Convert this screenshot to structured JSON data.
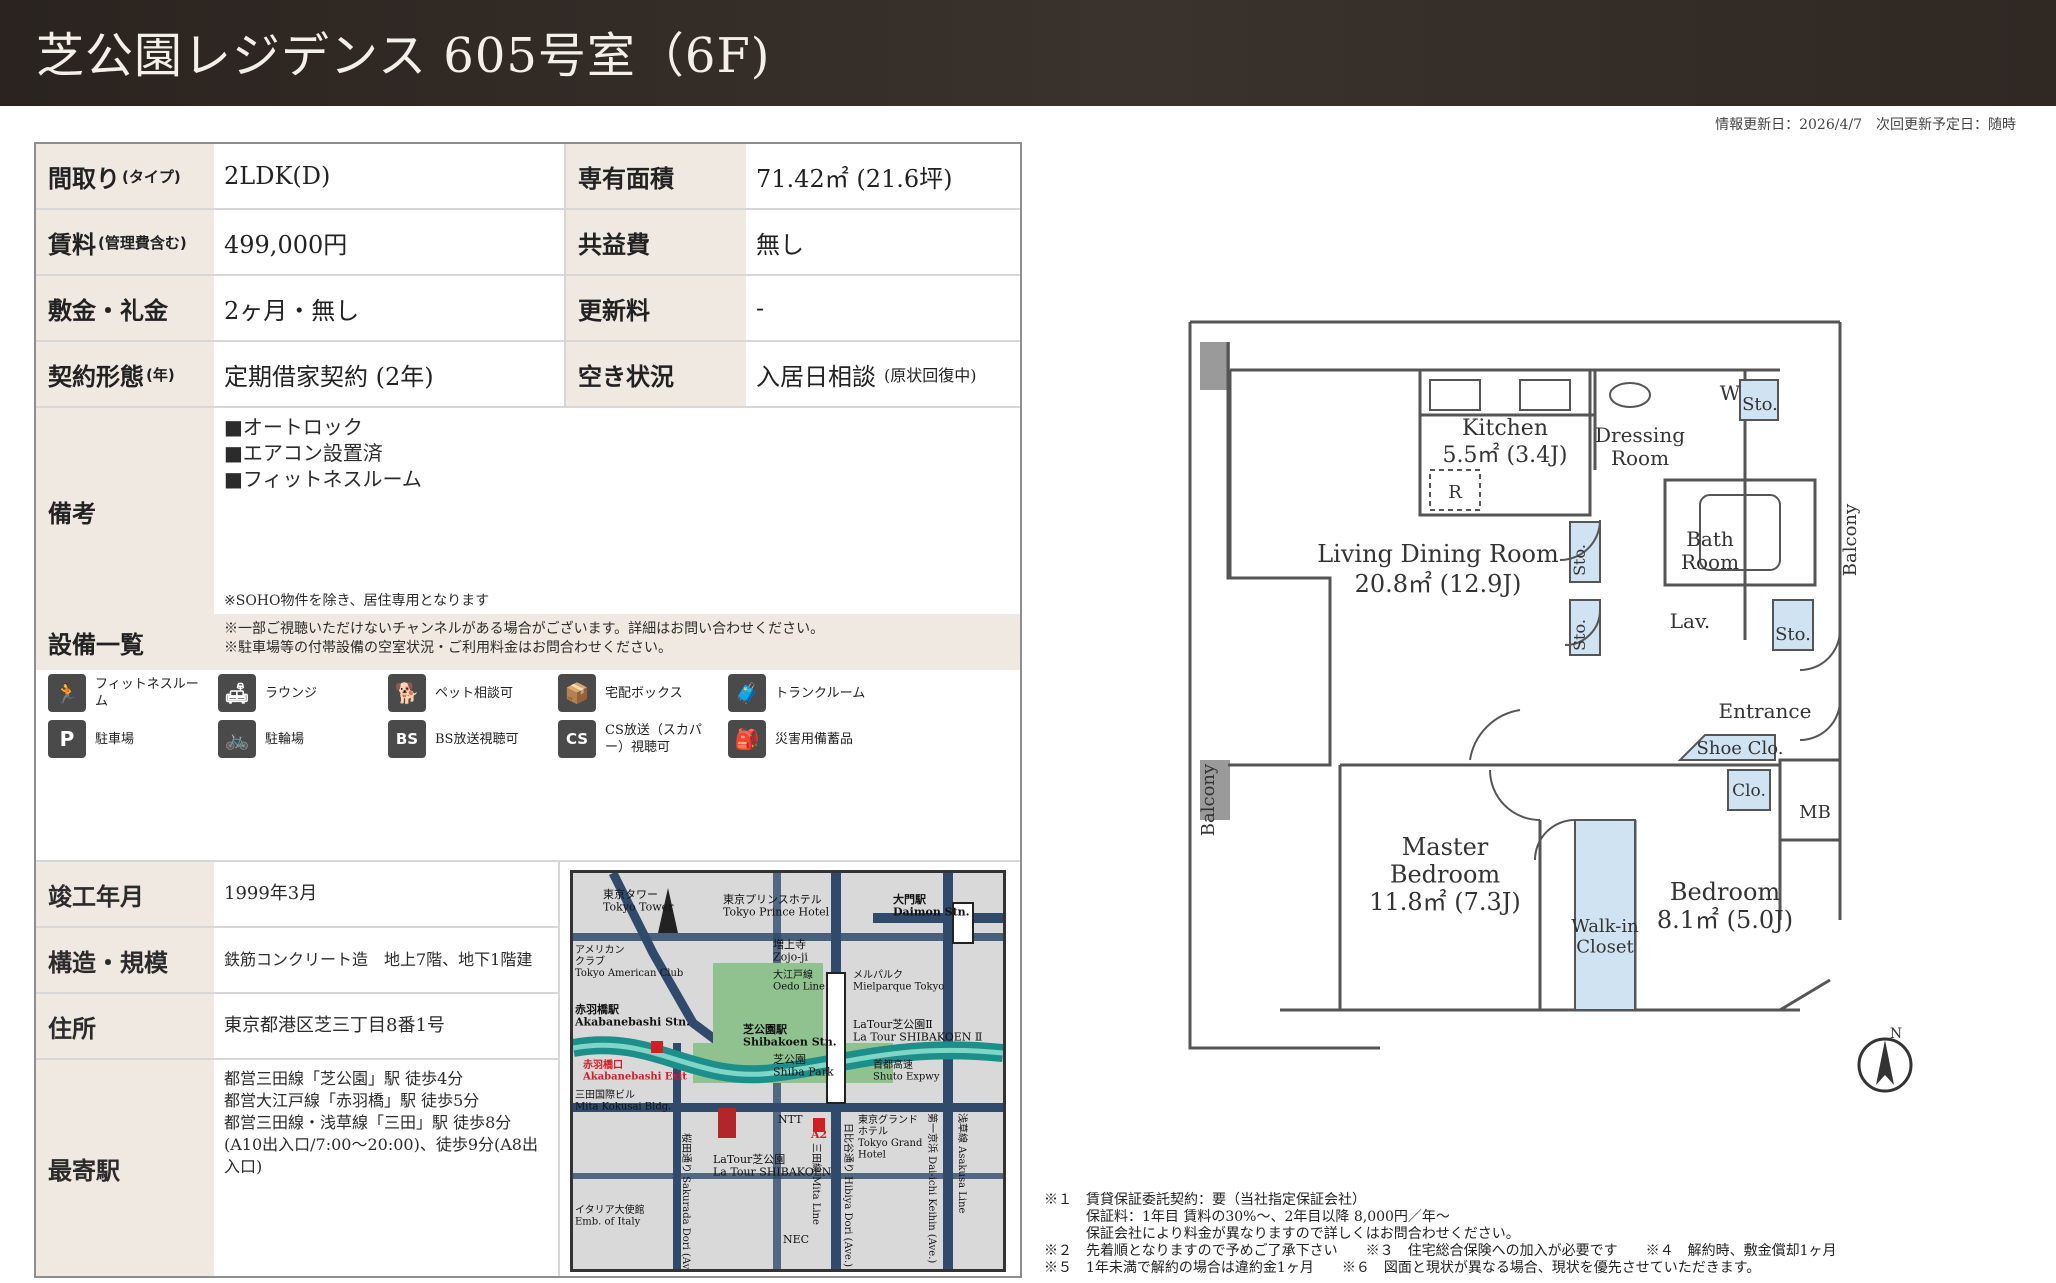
{
  "header": {
    "title": "芝公園レジデンス 605号室（6F)"
  },
  "update_info": "情報更新日：2026/4/7　次回更新予定日：随時",
  "details": {
    "madori_label": "間取り",
    "madori_sub": "(タイプ)",
    "madori_value": "2LDK(D)",
    "area_label": "専有面積",
    "area_value": "71.42㎡ (21.6坪)",
    "rent_label": "賃料",
    "rent_sub": "(管理費含む)",
    "rent_value": "499,000円",
    "common_label": "共益費",
    "common_value": "無し",
    "deposit_label": "敷金・礼金",
    "deposit_value": "2ヶ月・無し",
    "renewal_label": "更新料",
    "renewal_value": "-",
    "contract_label": "契約形態",
    "contract_sub": "(年)",
    "contract_value": "定期借家契約 (2年)",
    "vacancy_label": "空き状況",
    "vacancy_value": "入居日相談",
    "vacancy_note": "(原状回復中)"
  },
  "remarks": {
    "label": "備考",
    "items": [
      "■オートロック",
      "■エアコン設置済",
      "■フィットネスルーム"
    ],
    "footnote": "※SOHO物件を除き、居住専用となります"
  },
  "equipment": {
    "label": "設備一覧",
    "notes": [
      "※一部ご視聴いただけないチャンネルがある場合がございます。詳細はお問い合わせください。",
      "※駐車場等の付帯設備の空室状況・ご利用料金はお問合わせください。"
    ],
    "items": [
      {
        "icon": "fitness-icon",
        "glyph": "🏃",
        "text": "フィットネスルーム"
      },
      {
        "icon": "lounge-icon",
        "glyph": "🛋",
        "text": "ラウンジ"
      },
      {
        "icon": "pet-icon",
        "glyph": "🐕",
        "text": "ペット相談可"
      },
      {
        "icon": "delivery-box-icon",
        "glyph": "📦",
        "text": "宅配ボックス"
      },
      {
        "icon": "trunk-room-icon",
        "glyph": "🧳",
        "text": "トランクルーム"
      },
      {
        "icon": "parking-icon",
        "glyph": "P",
        "text": "駐車場"
      },
      {
        "icon": "bicycle-icon",
        "glyph": "🚲",
        "text": "駐輪場"
      },
      {
        "icon": "bs-icon",
        "glyph": "BS",
        "text": "BS放送視聴可"
      },
      {
        "icon": "cs-icon",
        "glyph": "CS",
        "text": "CS放送（スカパー）視聴可"
      },
      {
        "icon": "disaster-kit-icon",
        "glyph": "🎒",
        "text": "災害用備蓄品"
      }
    ]
  },
  "building": {
    "completed_label": "竣工年月",
    "completed_value": "1999年3月",
    "structure_label": "構造・規模",
    "structure_value": "鉄筋コンクリート造　地上7階、地下1階建",
    "address_label": "住所",
    "address_value": "東京都港区芝三丁目8番1号",
    "station_label": "最寄駅",
    "station_lines": [
      "都営三田線「芝公園」駅 徒歩4分",
      "都営大江戸線「赤羽橋」駅 徒歩5分",
      "都営三田線・浅草線「三田」駅 徒歩8分(A10出入口/7:00〜20:00)、徒歩9分(A8出入口)"
    ]
  },
  "map": {
    "labels": {
      "tokyo_tower": "東京タワー\nTokyo Tower",
      "prince": "東京プリンスホテル\nTokyo Prince Hotel",
      "daimon": "大門駅\nDaimon Stn.",
      "zojoji": "増上寺\nZojo-ji",
      "american_club": "アメリカン\nクラブ\nTokyo American Club",
      "oedo": "大江戸線\nOedo Line",
      "mielparque": "メルパルク\nMielparque Tokyo",
      "akabanebashi_stn": "赤羽橋駅\nAkabanebashi Stn.",
      "shibakoen_stn": "芝公園駅\nShibakoen Stn.",
      "latour2": "LaTour芝公園Ⅱ\nLa Tour SHIBAKOEN Ⅱ",
      "akabanebashi_exit": "赤羽橋口\nAkabanebashi Exit",
      "shiba_park": "芝公園\nShiba Park",
      "shuto": "首都高速\nShuto Expwy",
      "mita_kokusai": "三田国際ビル\nMita Kokusai Bldg.",
      "ntt": "NTT",
      "a2": "A2",
      "grand_hotel": "東京グランド\nホテル\nTokyo Grand\nHotel",
      "latour": "LaTour芝公園\nLa Tour SHIBAKOEN",
      "italy_emb": "イタリア大使館\nEmb. of Italy",
      "nec": "NEC",
      "sakurada": "桜田通り Sakurada Dori (Ave.)",
      "mita_line": "三田線 Mita Line",
      "hibiya": "日比谷通り Hibiya Dori (Ave.)",
      "keihin": "第一京浜 Dai-ichi Keihin (Ave.)",
      "asakusa": "浅草線 Asakusa Line"
    }
  },
  "floorplan": {
    "kitchen": "Kitchen",
    "kitchen_area": "5.5㎡ (3.4J)",
    "dressing": "Dressing\nRoom",
    "w": "W",
    "sto": "Sto.",
    "r": "R",
    "ldr": "Living Dining Room",
    "ldr_area": "20.8㎡ (12.9J)",
    "bath": "Bath\nRoom",
    "balcony": "Balcony",
    "lav": "Lav.",
    "entrance": "Entrance",
    "shoe": "Shoe Clo.",
    "clo": "Clo.",
    "mb": "MB",
    "master": "Master\nBedroom",
    "master_area": "11.8㎡ (7.3J)",
    "walkin": "Walk-in\nCloset",
    "bedroom": "Bedroom",
    "bedroom_area": "8.1㎡ (5.0J)",
    "north": "N"
  },
  "footnotes": [
    "※１　賃貸保証委託契約：要（当社指定保証会社）",
    "　　　保証料：1年目 賃料の30%〜、2年目以降 8,000円／年〜",
    "　　　保証会社により料金が異なりますので詳しくはお問合わせください。",
    "※２　先着順となりますので予めご了承下さい　　※３　住宅総合保険への加入が必要です　　※４　解約時、敷金償却1ヶ月",
    "※５　1年未満で解約の場合は違約金1ヶ月　　※６　図面と現状が異なる場合、現状を優先させていただきます。"
  ]
}
